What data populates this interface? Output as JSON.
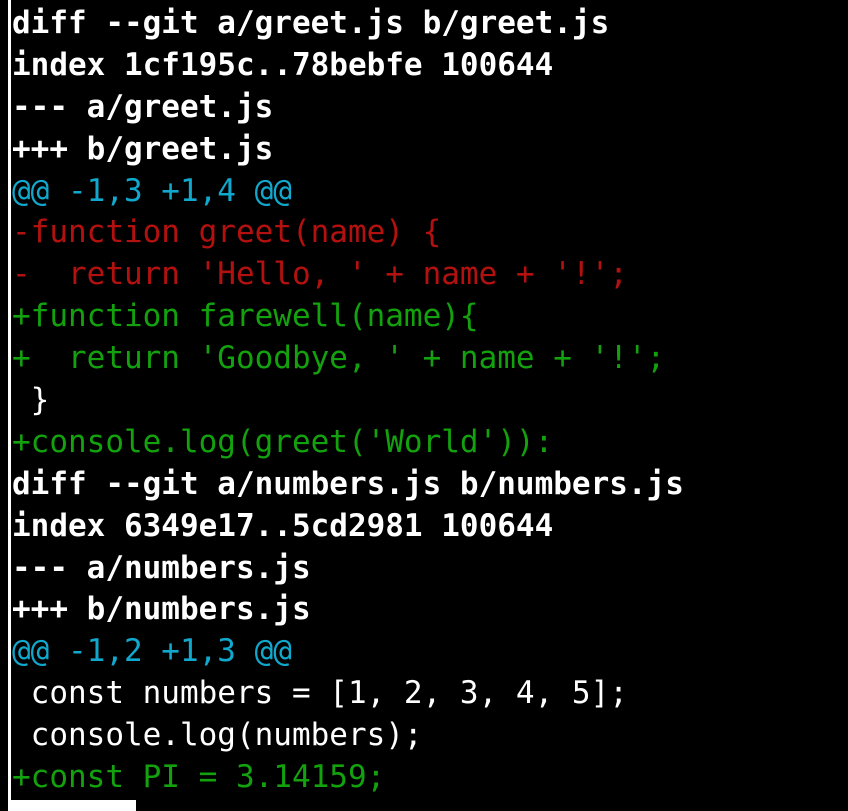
{
  "terminal": {
    "lines": [
      {
        "text": "diff --git a/greet.js b/greet.js",
        "kind": "meta"
      },
      {
        "text": "index 1cf195c..78bebfe 100644",
        "kind": "meta"
      },
      {
        "text": "--- a/greet.js",
        "kind": "meta"
      },
      {
        "text": "+++ b/greet.js",
        "kind": "meta"
      },
      {
        "text": "@@ -1,3 +1,4 @@",
        "kind": "hunk"
      },
      {
        "text": "-function greet(name) {",
        "kind": "del"
      },
      {
        "text": "-  return 'Hello, ' + name + '!';",
        "kind": "del"
      },
      {
        "text": "+function farewell(name){",
        "kind": "add"
      },
      {
        "text": "+  return 'Goodbye, ' + name + '!';",
        "kind": "add"
      },
      {
        "text": " }",
        "kind": "ctx"
      },
      {
        "text": "+console.log(greet('World')):",
        "kind": "add"
      },
      {
        "text": "diff --git a/numbers.js b/numbers.js",
        "kind": "meta"
      },
      {
        "text": "index 6349e17..5cd2981 100644",
        "kind": "meta"
      },
      {
        "text": "--- a/numbers.js",
        "kind": "meta"
      },
      {
        "text": "+++ b/numbers.js",
        "kind": "meta"
      },
      {
        "text": "@@ -1,2 +1,3 @@",
        "kind": "hunk"
      },
      {
        "text": " const numbers = [1, 2, 3, 4, 5];",
        "kind": "ctx"
      },
      {
        "text": " console.log(numbers);",
        "kind": "ctx"
      },
      {
        "text": "+const PI = 3.14159;",
        "kind": "add"
      }
    ]
  },
  "colors": {
    "background": "#000000",
    "meta": "#ffffff",
    "hunk": "#11a8cd",
    "deleted": "#b3110f",
    "added": "#13a10e",
    "context": "#ffffff"
  }
}
